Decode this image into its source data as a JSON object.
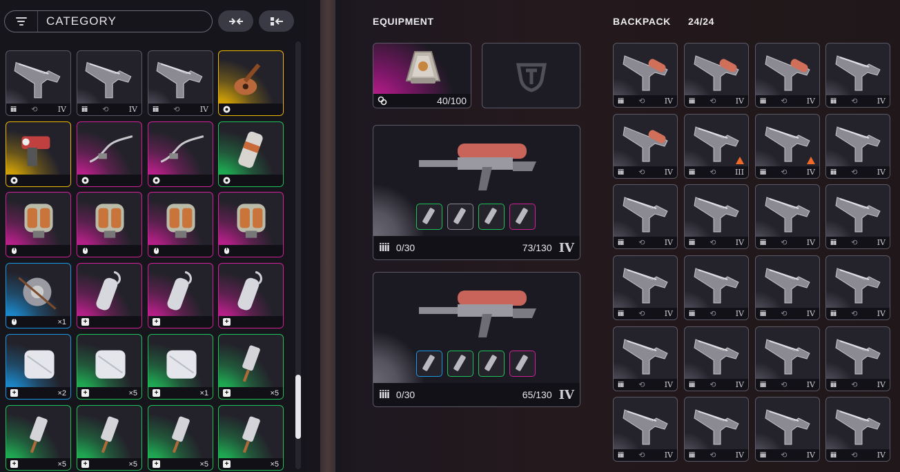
{
  "stash": {
    "filter_label": "CATEGORY",
    "btn_collapse": "→←",
    "btn_sort": "▶▪",
    "rows": [
      [
        {
          "type": "gun",
          "rarity": "none",
          "icon": "ammo",
          "roman": "IV"
        },
        {
          "type": "gun",
          "rarity": "none",
          "icon": "ammo",
          "roman": "IV"
        },
        {
          "type": "gun",
          "rarity": "none",
          "icon": "ammo",
          "roman": "IV"
        },
        {
          "type": "guitar",
          "rarity": "gold",
          "icon": "gear",
          "roman": ""
        }
      ],
      [
        {
          "type": "drill",
          "rarity": "gold",
          "icon": "gear",
          "roman": ""
        },
        {
          "type": "wire",
          "rarity": "pink",
          "icon": "gear",
          "roman": ""
        },
        {
          "type": "wire",
          "rarity": "pink",
          "icon": "gear",
          "roman": ""
        },
        {
          "type": "canister",
          "rarity": "green",
          "icon": "gear",
          "roman": ""
        }
      ],
      [
        {
          "type": "grenade",
          "rarity": "pink",
          "icon": "mouse",
          "roman": ""
        },
        {
          "type": "grenade",
          "rarity": "pink",
          "icon": "mouse",
          "roman": ""
        },
        {
          "type": "grenade",
          "rarity": "pink",
          "icon": "mouse",
          "roman": ""
        },
        {
          "type": "grenade",
          "rarity": "pink",
          "icon": "mouse",
          "roman": ""
        }
      ],
      [
        {
          "type": "mine",
          "rarity": "blue",
          "icon": "mouse",
          "count": "×1"
        },
        {
          "type": "spray",
          "rarity": "pink",
          "icon": "plus",
          "count": ""
        },
        {
          "type": "spray",
          "rarity": "pink",
          "icon": "plus",
          "count": ""
        },
        {
          "type": "spray",
          "rarity": "pink",
          "icon": "plus",
          "count": ""
        }
      ],
      [
        {
          "type": "bandage",
          "rarity": "blue",
          "icon": "plus",
          "count": "×2"
        },
        {
          "type": "bandage",
          "rarity": "green",
          "icon": "plus",
          "count": "×5"
        },
        {
          "type": "bandage",
          "rarity": "green",
          "icon": "plus",
          "count": "×1"
        },
        {
          "type": "injector",
          "rarity": "green",
          "icon": "plus",
          "count": "×5"
        }
      ],
      [
        {
          "type": "injector",
          "rarity": "green",
          "icon": "plus",
          "count": "×5"
        },
        {
          "type": "injector",
          "rarity": "green",
          "icon": "plus",
          "count": "×5"
        },
        {
          "type": "injector",
          "rarity": "green",
          "icon": "plus",
          "count": "×5"
        },
        {
          "type": "injector",
          "rarity": "green",
          "icon": "plus",
          "count": "×5"
        }
      ]
    ]
  },
  "equipment": {
    "title": "EQUIPMENT",
    "shield": {
      "value": "40/100"
    },
    "weapons": [
      {
        "ammo": "0/30",
        "reserve": "73/130",
        "tier": "IV",
        "attachments": [
          "green",
          "gray",
          "green",
          "pink"
        ]
      },
      {
        "ammo": "0/30",
        "reserve": "65/130",
        "tier": "IV",
        "attachments": [
          "blue",
          "green",
          "green",
          "pink"
        ]
      }
    ]
  },
  "backpack": {
    "title": "BACKPACK",
    "count": "24/24",
    "items": [
      {
        "type": "heavy",
        "roman": "IV"
      },
      {
        "type": "heavy",
        "roman": "IV"
      },
      {
        "type": "heavy",
        "roman": "IV"
      },
      {
        "type": "gun",
        "roman": "IV"
      },
      {
        "type": "heavy",
        "roman": "IV"
      },
      {
        "type": "gun",
        "roman": "III",
        "warn": true
      },
      {
        "type": "gun",
        "roman": "IV",
        "warn": true
      },
      {
        "type": "gun",
        "roman": "IV"
      },
      {
        "type": "gun",
        "roman": "IV"
      },
      {
        "type": "gun",
        "roman": "IV"
      },
      {
        "type": "gun",
        "roman": "IV"
      },
      {
        "type": "gun",
        "roman": "IV"
      },
      {
        "type": "gun",
        "roman": "IV"
      },
      {
        "type": "gun",
        "roman": "IV"
      },
      {
        "type": "gun",
        "roman": "IV"
      },
      {
        "type": "gun",
        "roman": "IV"
      },
      {
        "type": "gun",
        "roman": "IV"
      },
      {
        "type": "gun",
        "roman": "IV"
      },
      {
        "type": "gun",
        "roman": "IV"
      },
      {
        "type": "gun",
        "roman": "IV"
      },
      {
        "type": "gun",
        "roman": "IV"
      },
      {
        "type": "gun",
        "roman": "IV"
      },
      {
        "type": "gun",
        "roman": "IV"
      },
      {
        "type": "gun",
        "roman": "IV"
      }
    ]
  },
  "colors": {
    "pink": "#d21f9a",
    "gold": "#f0b800",
    "green": "#1ec45a",
    "blue": "#1a9ae6",
    "none": "#4a4854",
    "orange": "#f06a2a"
  }
}
